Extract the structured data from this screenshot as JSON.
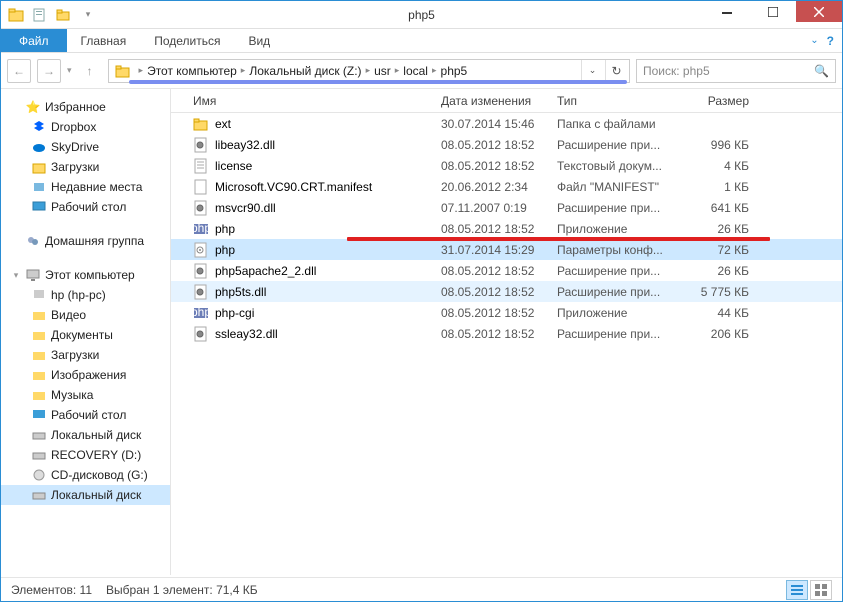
{
  "title": "php5",
  "ribbon": {
    "file": "Файл",
    "tabs": [
      "Главная",
      "Поделиться",
      "Вид"
    ]
  },
  "breadcrumb": [
    "Этот компьютер",
    "Локальный диск (Z:)",
    "usr",
    "local",
    "php5"
  ],
  "search_placeholder": "Поиск: php5",
  "sidebar": {
    "favorites": {
      "label": "Избранное",
      "items": [
        {
          "label": "Dropbox",
          "icon": "dropbox"
        },
        {
          "label": "SkyDrive",
          "icon": "skydrive"
        },
        {
          "label": "Загрузки",
          "icon": "download"
        },
        {
          "label": "Недавние места",
          "icon": "recent"
        },
        {
          "label": "Рабочий стол",
          "icon": "desktop"
        }
      ]
    },
    "homegroup": {
      "label": "Домашняя группа"
    },
    "computer": {
      "label": "Этот компьютер",
      "items": [
        {
          "label": "hp (hp-pc)",
          "icon": "pc"
        },
        {
          "label": "Видео",
          "icon": "video"
        },
        {
          "label": "Документы",
          "icon": "docs"
        },
        {
          "label": "Загрузки",
          "icon": "download"
        },
        {
          "label": "Изображения",
          "icon": "pics"
        },
        {
          "label": "Музыка",
          "icon": "music"
        },
        {
          "label": "Рабочий стол",
          "icon": "desktop"
        },
        {
          "label": "Локальный диск",
          "icon": "drive"
        },
        {
          "label": "RECOVERY (D:)",
          "icon": "drive"
        },
        {
          "label": "CD-дисковод (G:)",
          "icon": "cd"
        },
        {
          "label": "Локальный диск",
          "icon": "drive",
          "selected": true
        }
      ]
    }
  },
  "columns": {
    "name": "Имя",
    "date": "Дата изменения",
    "type": "Тип",
    "size": "Размер"
  },
  "files": [
    {
      "name": "ext",
      "date": "30.07.2014 15:46",
      "type": "Папка с файлами",
      "size": "",
      "icon": "folder"
    },
    {
      "name": "libeay32.dll",
      "date": "08.05.2012 18:52",
      "type": "Расширение при...",
      "size": "996 КБ",
      "icon": "dll"
    },
    {
      "name": "license",
      "date": "08.05.2012 18:52",
      "type": "Текстовый докум...",
      "size": "4 КБ",
      "icon": "txt"
    },
    {
      "name": "Microsoft.VC90.CRT.manifest",
      "date": "20.06.2012 2:34",
      "type": "Файл \"MANIFEST\"",
      "size": "1 КБ",
      "icon": "file"
    },
    {
      "name": "msvcr90.dll",
      "date": "07.11.2007 0:19",
      "type": "Расширение при...",
      "size": "641 КБ",
      "icon": "dll"
    },
    {
      "name": "php",
      "date": "08.05.2012 18:52",
      "type": "Приложение",
      "size": "26 КБ",
      "icon": "php"
    },
    {
      "name": "php",
      "date": "31.07.2014 15:29",
      "type": "Параметры конф...",
      "size": "72 КБ",
      "icon": "ini",
      "selected": true,
      "highlighted": true
    },
    {
      "name": "php5apache2_2.dll",
      "date": "08.05.2012 18:52",
      "type": "Расширение при...",
      "size": "26 КБ",
      "icon": "dll"
    },
    {
      "name": "php5ts.dll",
      "date": "08.05.2012 18:52",
      "type": "Расширение при...",
      "size": "5 775 КБ",
      "icon": "dll",
      "hover": true
    },
    {
      "name": "php-cgi",
      "date": "08.05.2012 18:52",
      "type": "Приложение",
      "size": "44 КБ",
      "icon": "php"
    },
    {
      "name": "ssleay32.dll",
      "date": "08.05.2012 18:52",
      "type": "Расширение при...",
      "size": "206 КБ",
      "icon": "dll"
    }
  ],
  "status": {
    "count_label": "Элементов:",
    "count": "11",
    "sel_label": "Выбран 1 элемент: 71,4 КБ"
  }
}
